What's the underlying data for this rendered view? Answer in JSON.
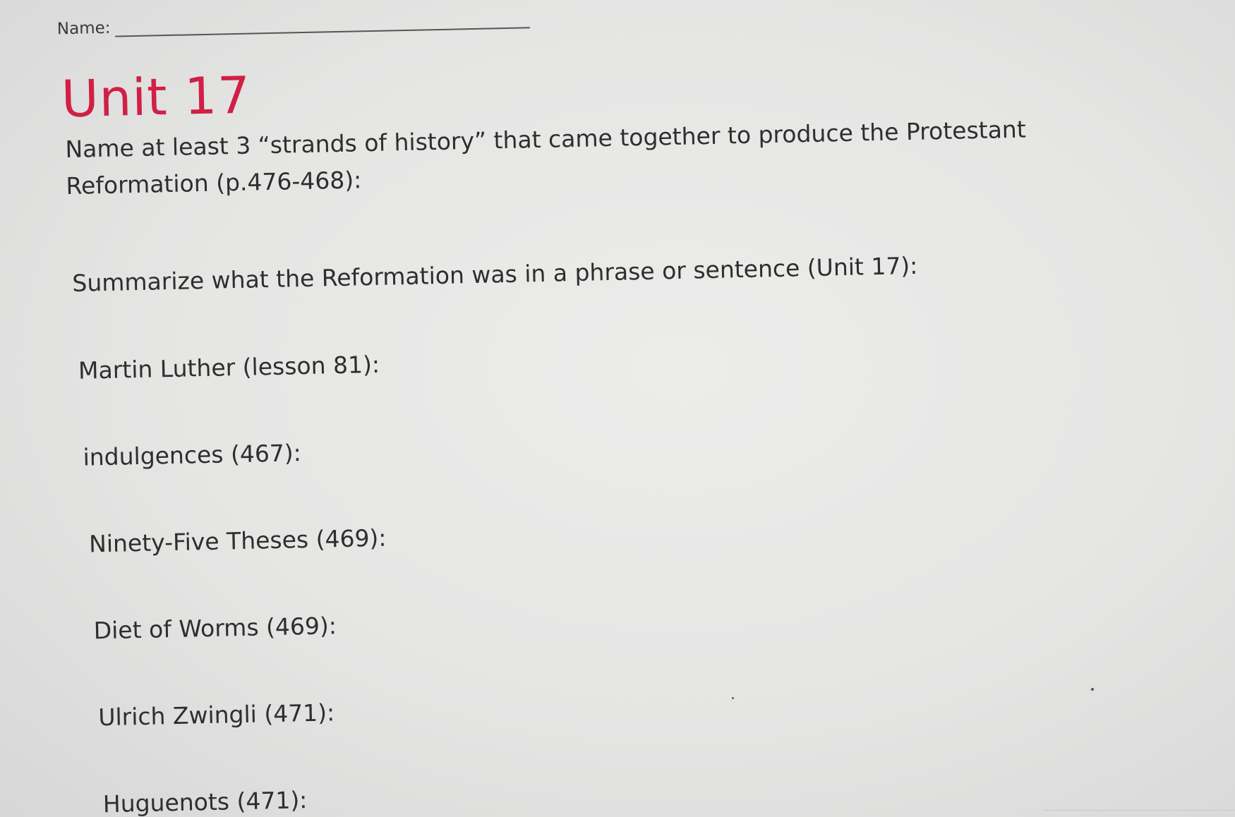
{
  "header": {
    "name_label": "Name:"
  },
  "unit_title": "Unit 17",
  "questions": [
    "Name at least 3 “strands of history” that came together to produce the Protestant Reformation (p.476-468):",
    "Summarize what the Reformation was in a phrase or sentence (Unit 17):",
    "Martin Luther (lesson 81):",
    "indulgences (467):",
    "Ninety-Five Theses (469):",
    "Diet of Worms (469):",
    "Ulrich Zwingli (471):",
    "Huguenots (471):"
  ],
  "colors": {
    "title": "#d11f45",
    "text": "#2e2e2e",
    "background": "#e7e7e6"
  }
}
